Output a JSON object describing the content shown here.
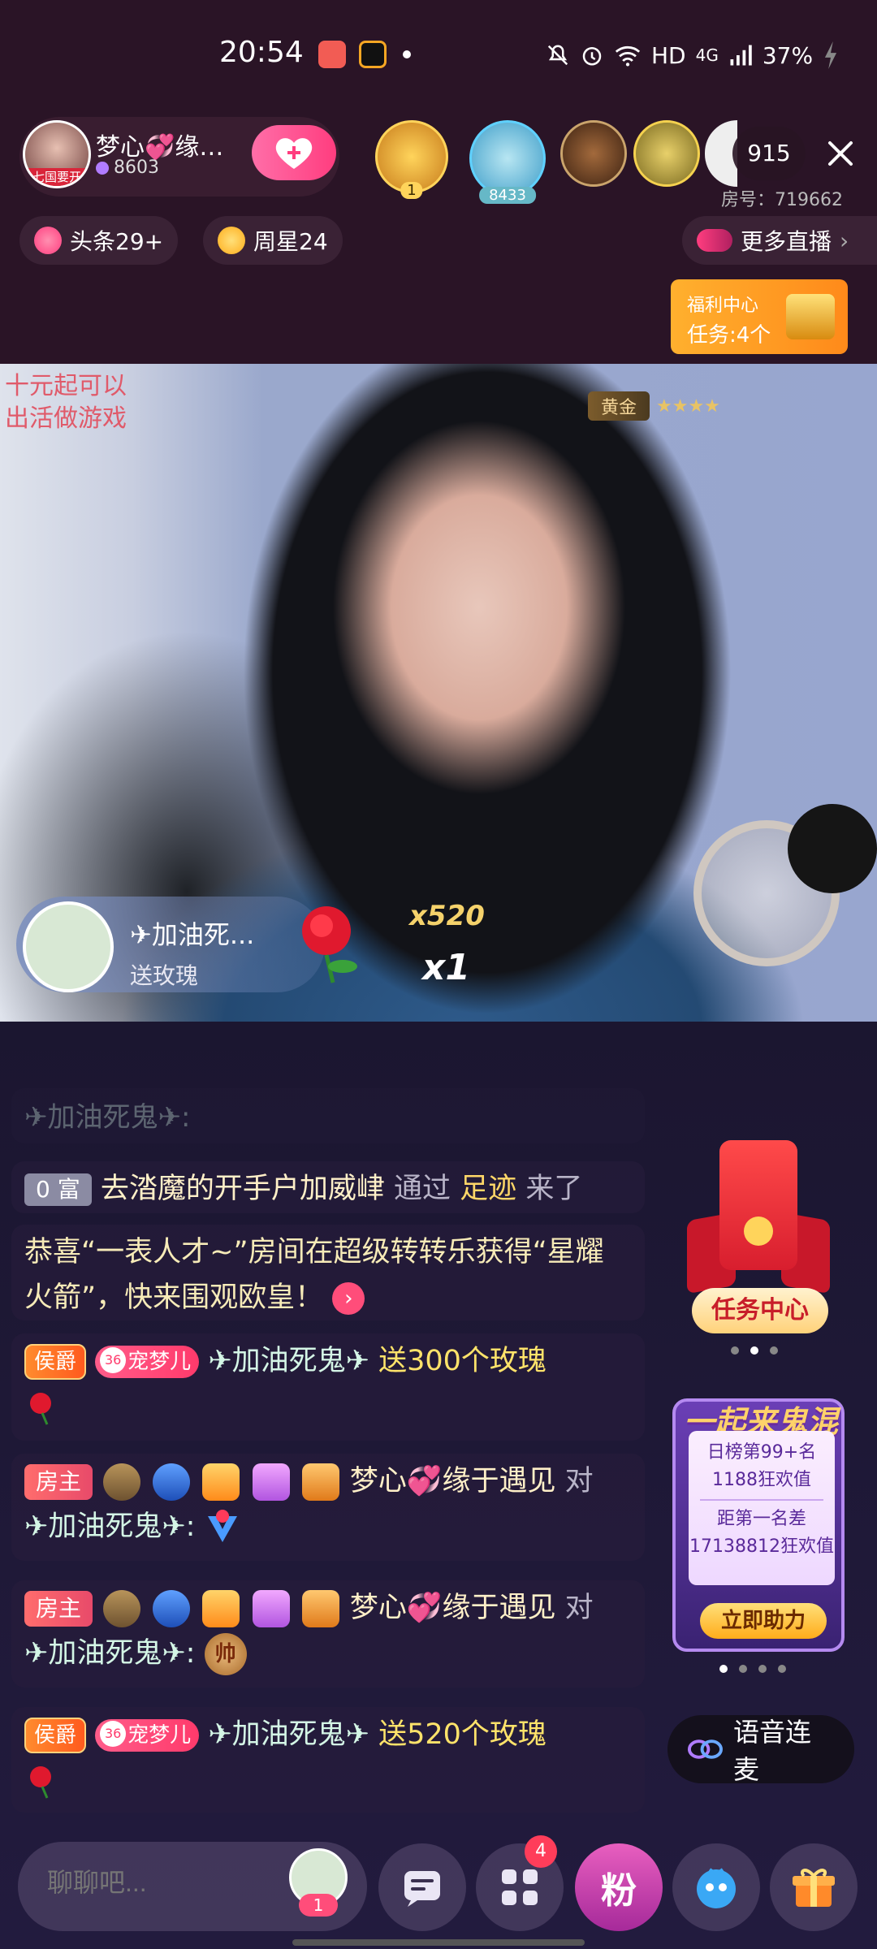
{
  "status_bar": {
    "time": "20:54",
    "network": "HD",
    "signal": "4G",
    "battery": "37%"
  },
  "host": {
    "name": "梦心💞缘…",
    "fans": "8603",
    "avatar_tag": "七国要开"
  },
  "audience": {
    "top1_level": "1",
    "top2_score": "8433",
    "viewer_count": "915",
    "room_id": "房号：719662"
  },
  "chips": {
    "headline": "头条29+",
    "week_star": "周星24",
    "more_live": "更多直播"
  },
  "welfare": {
    "title": "福利中心",
    "tasks": "任务:4个"
  },
  "video": {
    "overlay_text_1": "十元起可以",
    "overlay_text_2": "出活做游戏",
    "rank_label": "黄金"
  },
  "gift_toast": {
    "user": "✈加油死...",
    "action": "送玫瑰",
    "count": "x520",
    "multiplier": "x1"
  },
  "chat": {
    "partial": "✈加油死鬼✈:",
    "msg1": {
      "level": "0 富",
      "name": "去涾魔的开手户加威峍",
      "via": "通过",
      "source": "足迹",
      "action": "来了"
    },
    "msg2": {
      "text": "恭喜“一表人才~”房间在超级转转乐获得“星耀火箭”，快来围观欧皇！"
    },
    "msg3": {
      "duke": "侯爵",
      "pet": "宠梦儿",
      "name": "✈加油死鬼✈",
      "gift": "送300个玫瑰"
    },
    "msg4": {
      "host_tag": "房主",
      "name": "梦心💞缘于遇见",
      "to": "对",
      "target": "✈加油死鬼✈:"
    },
    "msg5": {
      "host_tag": "房主",
      "name": "梦心💞缘于遇见",
      "to": "对",
      "target": "✈加油死鬼✈:",
      "emote": "帅"
    },
    "msg6": {
      "duke": "侯爵",
      "pet": "宠梦儿",
      "name": "✈加油死鬼✈",
      "gift": "送520个玫瑰"
    }
  },
  "task_center": {
    "label": "任务中心"
  },
  "ghost_event": {
    "title": "一起来鬼混",
    "rank": "日榜第99+名",
    "score": "1188狂欢值",
    "gap_label": "距第一名差",
    "gap_value": "17138812狂欢值",
    "button": "立即助力"
  },
  "voice_link": {
    "label": "语音连麦"
  },
  "bottom_bar": {
    "placeholder": "聊聊吧...",
    "avatar_badge": "1",
    "apps_badge": "4",
    "fans_label": "粉"
  },
  "colors": {
    "accent_pink": "#ff3d7f",
    "gold": "#ffd768",
    "background": "#1b1630"
  }
}
